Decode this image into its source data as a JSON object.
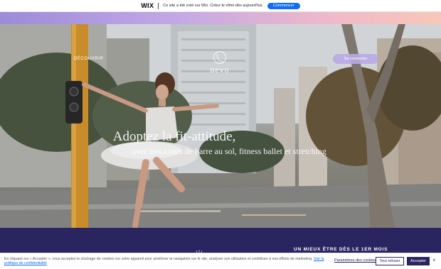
{
  "banner": {
    "logo": "WIX",
    "message": "Ce site a été créé sur Wix. Créez le vôtre dès aujourd'hui.",
    "cta": "Commencer"
  },
  "nav": {
    "discover": "DÉCOUVRIR",
    "logo_text": "nevo",
    "login": "Se connecter"
  },
  "hero": {
    "title": "Adoptez la fit-attitude,",
    "subtitle": "avec nos cours de barre au sol, fitness ballet et stretching"
  },
  "section": {
    "heading": "UN MIEUX ÊTRE DÈS LE 1ER MOIS"
  },
  "cookie": {
    "text": "En cliquant sur « Accepter », vous acceptez le stockage de cookies sur votre appareil pour améliorer la navigation sur le site, analyser son utilisation et contribuer à nos efforts de marketing.",
    "link": "Voir la politique de confidentialité",
    "settings": "Paramètres des cookies",
    "refuse": "Tout refuser",
    "accept": "Accepter",
    "close": "×"
  },
  "colors": {
    "wix_blue": "#116dff",
    "purple_dark": "#2a2560",
    "login_bg": "#b9aae6"
  }
}
